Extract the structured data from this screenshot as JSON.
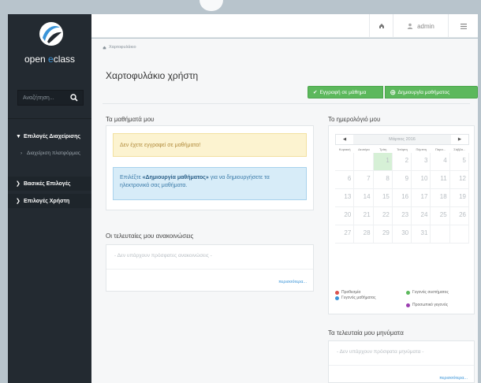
{
  "app": {
    "logo_text_prefix": "open ",
    "logo_text_accent": "e",
    "logo_text_suffix": "class",
    "accent_color": "#3a94d8",
    "success_color": "#5cb85c"
  },
  "sidebar": {
    "search_placeholder": "Αναζήτηση...",
    "sections": [
      {
        "label": "Επιλογές Διαχείρισης",
        "expanded": true,
        "chevron": "chevron-down-icon"
      },
      {
        "label": "Βασικές Επιλογές",
        "expanded": false,
        "chevron": "chevron-right-icon"
      },
      {
        "label": "Επιλογές Χρήστη",
        "expanded": false,
        "chevron": "chevron-right-icon"
      }
    ],
    "sub_items": [
      {
        "label": "Διαχείριση πλατφόρμας"
      }
    ]
  },
  "header": {
    "home_icon": "home-icon",
    "user_icon": "user-icon",
    "username": "admin",
    "menu_icon": "menu-icon"
  },
  "main": {
    "breadcrumb": "Χαρτοφυλάκιο",
    "page_title": "Χαρτοφυλάκιο χρήστη",
    "buttons": {
      "enroll": "Εγγραφή σε μάθημα",
      "create": "Δημιουργία μαθήματος"
    },
    "courses": {
      "title": "Τα μαθήματά μου",
      "warning": "Δεν έχετε εγγραφεί σε μαθήματα!",
      "info_prefix": "Επιλέξτε ",
      "info_bold": "«Δημιουργία μαθήματος»",
      "info_suffix": " για να δημιουργήσετε τα ηλεκτρονικά σας μαθήματα."
    },
    "announcements": {
      "title": "Οι τελευταίες μου ανακοινώσεις",
      "empty": "- Δεν υπάρχουν πρόσφατες ανακοινώσεις -",
      "more": "περισσότερα..."
    },
    "calendar": {
      "title": "Το ημερολόγιό μου",
      "month": "Μάρτιος 2016",
      "prev": "◀",
      "next": "▶",
      "weekdays": [
        "Κυριακή",
        "Δευτέρα",
        "Τρίτη",
        "Τετάρτη",
        "Πέμπτη",
        "Παρα...",
        "Σάββα..."
      ],
      "weeks": [
        [
          "",
          "",
          "1",
          "2",
          "3",
          "4",
          "5"
        ],
        [
          "6",
          "7",
          "8",
          "9",
          "10",
          "11",
          "12"
        ],
        [
          "13",
          "14",
          "15",
          "16",
          "17",
          "18",
          "19"
        ],
        [
          "20",
          "21",
          "22",
          "23",
          "24",
          "25",
          "26"
        ],
        [
          "27",
          "28",
          "29",
          "30",
          "31",
          "",
          ""
        ]
      ],
      "today": "1",
      "legend": [
        {
          "label": "Προθεσμία",
          "color": "#d9534f"
        },
        {
          "label": "Γεγονός μαθήματος",
          "color": "#3a94d8"
        },
        {
          "label": "Γεγονός συστήματος",
          "color": "#5cb85c"
        },
        {
          "label": "Προσωπικό γεγονός",
          "color": "#9b3fb0"
        }
      ]
    },
    "messages": {
      "title": "Τα τελευταία μου μηνύματα",
      "empty": "- Δεν υπάρχουν πρόσφατα μηνύματα -",
      "more": "περισσότερα..."
    }
  }
}
